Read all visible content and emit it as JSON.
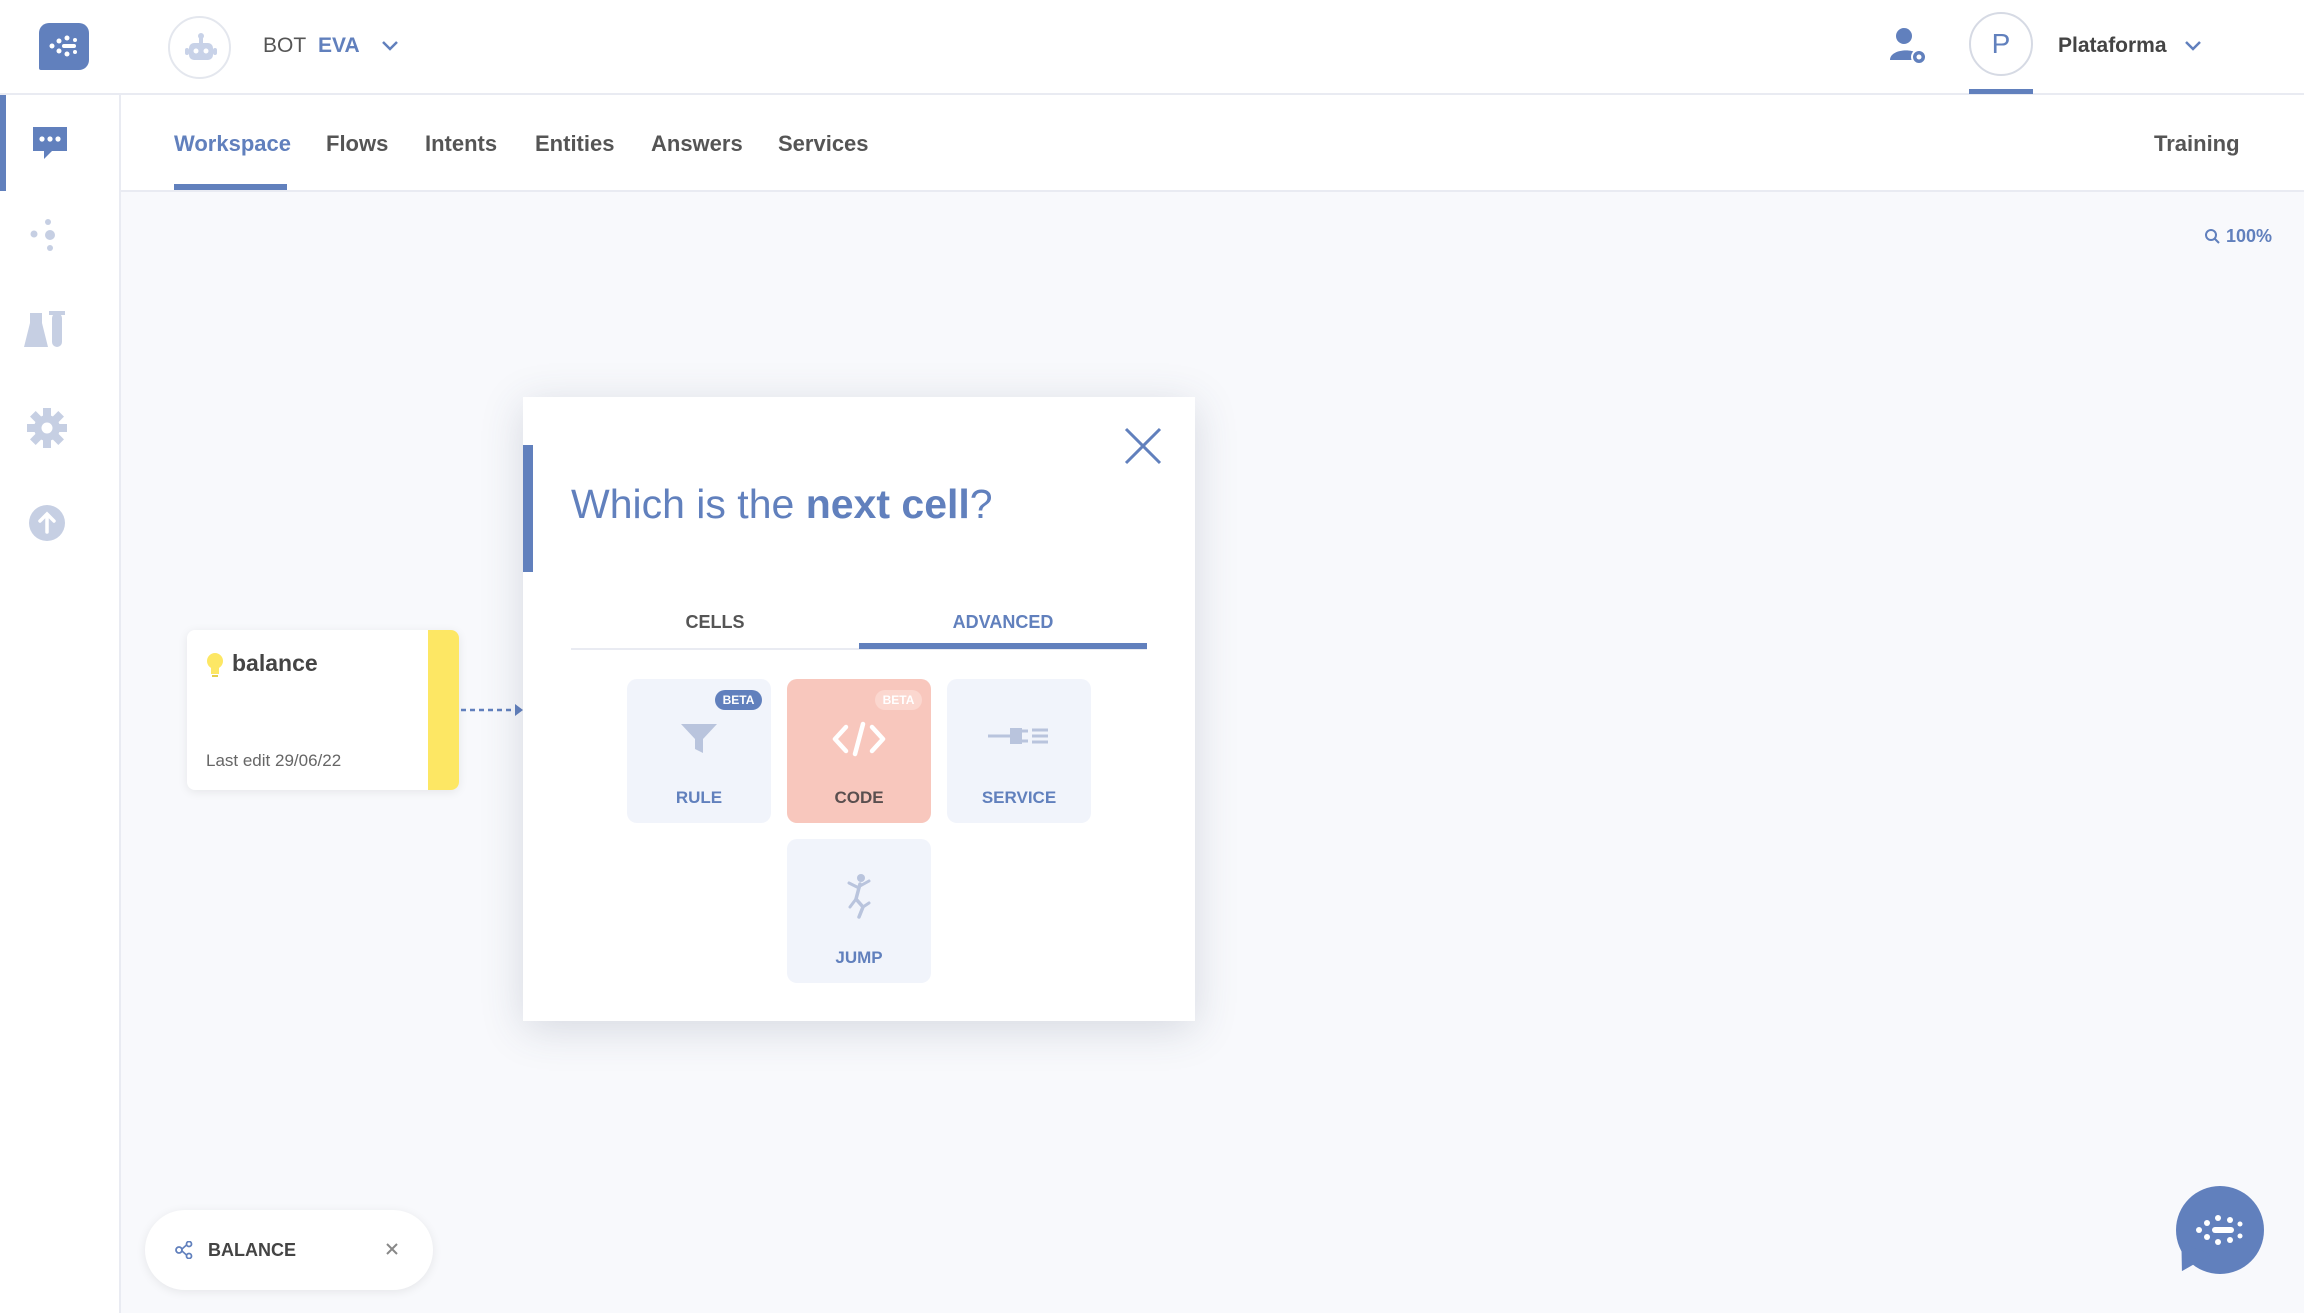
{
  "header": {
    "bot_label": "BOT",
    "bot_name": "EVA",
    "platform_avatar_letter": "P",
    "platform_name": "Plataforma"
  },
  "sidebar": {
    "items": [
      {
        "icon": "chat-icon",
        "active": true
      },
      {
        "icon": "flows-icon",
        "active": false
      },
      {
        "icon": "lab-icon",
        "active": false
      },
      {
        "icon": "gear-icon",
        "active": false
      },
      {
        "icon": "upload-icon",
        "active": false
      }
    ]
  },
  "tabs": {
    "items": [
      "Workspace",
      "Flows",
      "Intents",
      "Entities",
      "Answers",
      "Services"
    ],
    "active": "Workspace",
    "training": "Training"
  },
  "canvas": {
    "zoom": "100%",
    "intent_card": {
      "name": "balance",
      "last_edit": "Last edit 29/06/22"
    }
  },
  "modal": {
    "title_pre": "Which is the ",
    "title_bold": "next cell",
    "title_post": "?",
    "tabs": [
      "CELLS",
      "ADVANCED"
    ],
    "active_tab": "ADVANCED",
    "options": {
      "rule": {
        "label": "RULE",
        "badge": "BETA"
      },
      "code": {
        "label": "CODE",
        "badge": "BETA"
      },
      "service": {
        "label": "SERVICE"
      },
      "jump": {
        "label": "JUMP"
      }
    }
  },
  "flow_pill": {
    "label": "BALANCE"
  },
  "colors": {
    "accent": "#6180bd",
    "intent_stripe": "#fde764",
    "code_highlight": "#f8c7bd"
  }
}
